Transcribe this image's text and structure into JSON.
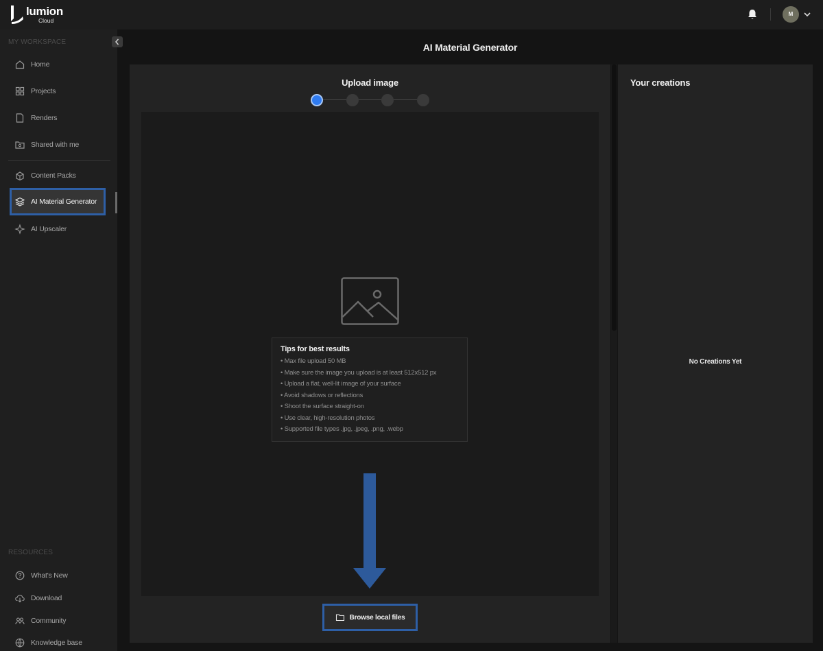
{
  "app": {
    "brand": "lumion",
    "brand_sub": "Cloud",
    "avatar_initial": "M"
  },
  "sidebar": {
    "workspace_label": "MY WORKSPACE",
    "items": [
      {
        "label": "Home",
        "icon": "home-icon"
      },
      {
        "label": "Projects",
        "icon": "grid-icon"
      },
      {
        "label": "Renders",
        "icon": "document-icon"
      },
      {
        "label": "Shared with me",
        "icon": "shared-folder-icon"
      },
      {
        "label": "Content Packs",
        "icon": "packs-icon"
      },
      {
        "label": "AI Material Generator",
        "icon": "layers-icon",
        "active": true
      },
      {
        "label": "AI Upscaler",
        "icon": "sparkle-icon"
      }
    ],
    "resources_label": "RESOURCES",
    "resources": [
      {
        "label": "What's New",
        "icon": "question-icon"
      },
      {
        "label": "Download",
        "icon": "download-cloud-icon"
      },
      {
        "label": "Community",
        "icon": "community-icon"
      },
      {
        "label": "Knowledge base",
        "icon": "globe-icon"
      }
    ]
  },
  "main": {
    "title": "AI Material Generator",
    "upload": {
      "title": "Upload image",
      "steps_total": 4,
      "current_step": 1,
      "tips_title": "Tips for best results",
      "tips": [
        "• Max file upload 50 MB",
        "• Make sure the image you upload is at least 512x512 px",
        "• Upload a flat, well-lit image of your surface",
        "• Avoid shadows or reflections",
        "• Shoot the surface straight-on",
        "• Use clear, high-resolution photos",
        "• Supported file types .jpg, .jpeg, .png, .webp"
      ],
      "browse_label": "Browse local files"
    },
    "creations": {
      "title": "Your creations",
      "empty_text": "No Creations Yet"
    }
  },
  "colors": {
    "accent": "#2f7bf0",
    "highlight": "#2e5fa6",
    "background": "#141414",
    "panel": "#232323"
  }
}
